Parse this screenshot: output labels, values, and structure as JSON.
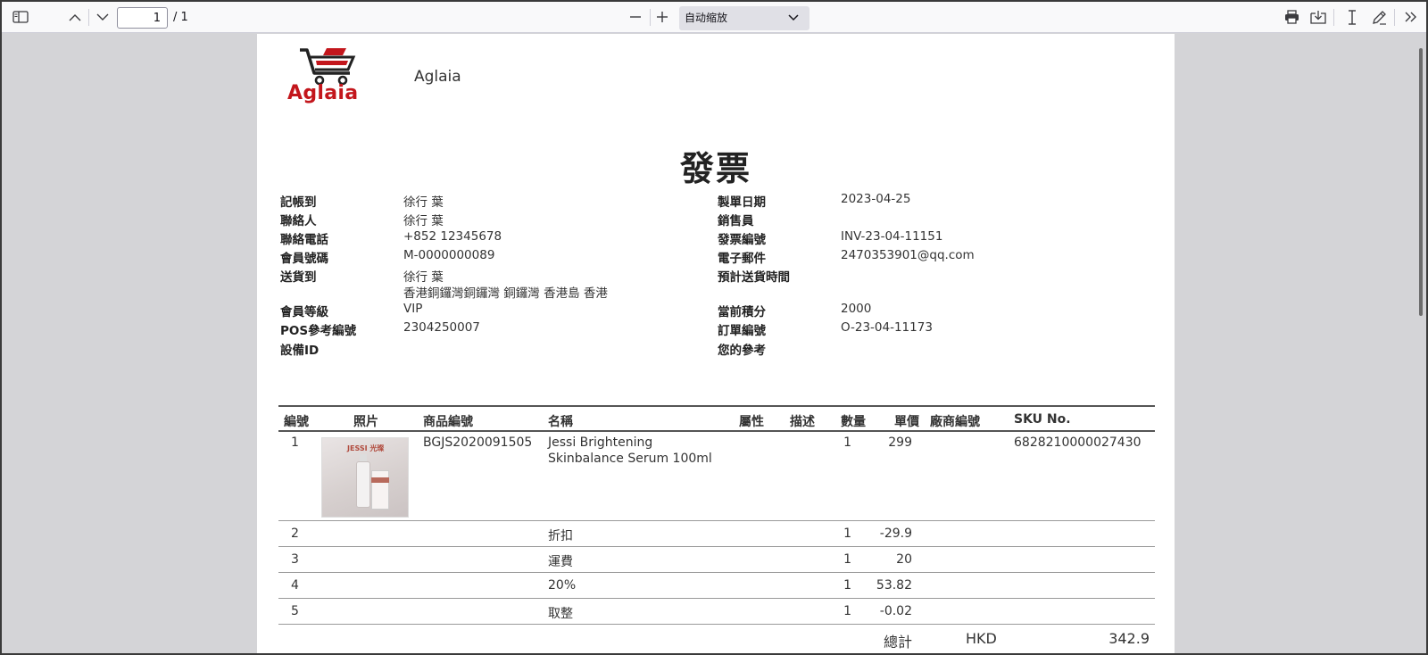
{
  "toolbar": {
    "page_current": "1",
    "page_total": "/ 1",
    "zoom_label": "自动缩放"
  },
  "document": {
    "company_logo_text": "Aglaia",
    "company_name": "Aglaia",
    "title": "發票"
  },
  "info_left": [
    {
      "label": "記帳到",
      "value": "徐行 葉"
    },
    {
      "label": "聯絡人",
      "value": "徐行 葉"
    },
    {
      "label": "聯絡電話",
      "value": "+852 12345678"
    },
    {
      "label": "會員號碼",
      "value": "M-0000000089"
    },
    {
      "label": "送貨到",
      "value": "徐行 葉",
      "value2": "香港銅鑼灣銅鑼灣 銅鑼灣 香港島 香港"
    },
    {
      "label": "會員等級",
      "value": "VIP"
    },
    {
      "label": "POS參考編號",
      "value": "2304250007"
    },
    {
      "label": "設備ID",
      "value": ""
    }
  ],
  "info_right": [
    {
      "label": "製單日期",
      "value": "2023-04-25"
    },
    {
      "label": "銷售員",
      "value": ""
    },
    {
      "label": "發票編號",
      "value": "INV-23-04-11151"
    },
    {
      "label": "電子郵件",
      "value": "2470353901@qq.com"
    },
    {
      "label": "預計送貨時間",
      "value": ""
    },
    {
      "label": "當前積分",
      "value": "2000"
    },
    {
      "label": "訂單編號",
      "value": "O-23-04-11173"
    },
    {
      "label": "您的參考",
      "value": ""
    }
  ],
  "table": {
    "headers": {
      "no": "編號",
      "photo": "照片",
      "code": "商品編號",
      "name": "名稱",
      "attr": "屬性",
      "desc": "描述",
      "qty": "數量",
      "price": "單價",
      "vendor": "廠商編號",
      "sku": "SKU No."
    },
    "rows": [
      {
        "no": "1",
        "code": "BGJS2020091505",
        "name": "Jessi Brightening",
        "name2": "Skinbalance Serum 100ml",
        "qty": "1",
        "price": "299",
        "sku": "6828210000027430",
        "photo_brand": "JESSI 光璨"
      },
      {
        "no": "2",
        "code": "",
        "name": "折扣",
        "qty": "1",
        "price": "-29.9",
        "sku": ""
      },
      {
        "no": "3",
        "code": "",
        "name": "運費",
        "qty": "1",
        "price": "20",
        "sku": ""
      },
      {
        "no": "4",
        "code": "",
        "name": "20%",
        "qty": "1",
        "price": "53.82",
        "sku": ""
      },
      {
        "no": "5",
        "code": "",
        "name": "取整",
        "qty": "1",
        "price": "-0.02",
        "sku": ""
      }
    ]
  },
  "total": {
    "label": "總計",
    "currency": "HKD",
    "amount": "342.9"
  }
}
